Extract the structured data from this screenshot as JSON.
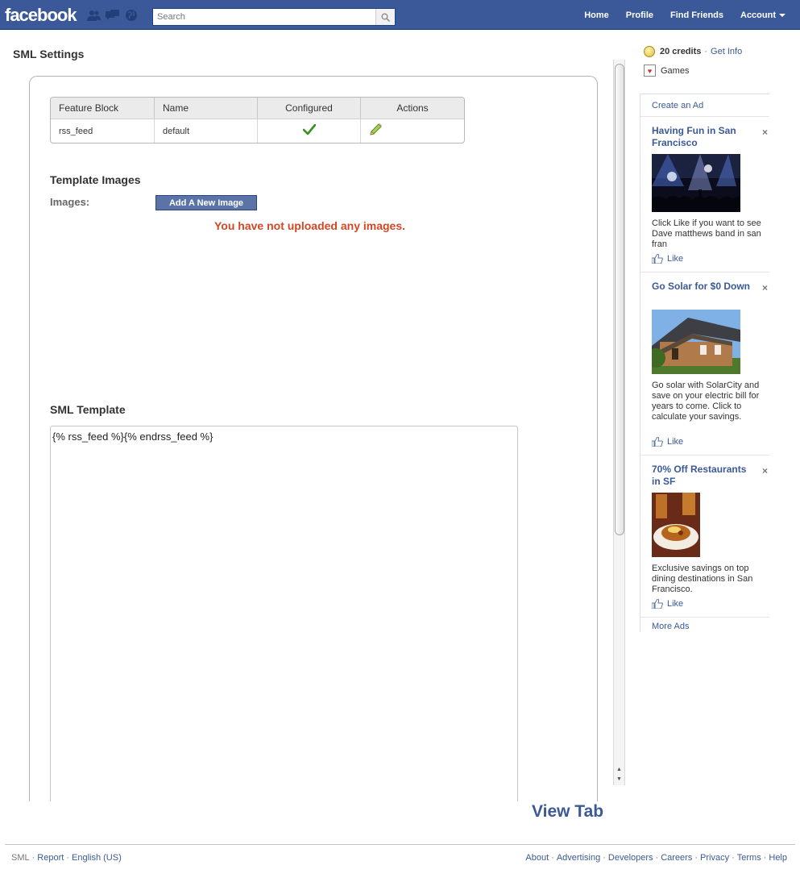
{
  "topbar": {
    "logo": "facebook",
    "search_placeholder": "Search",
    "nav": [
      "Home",
      "Profile",
      "Find Friends",
      "Account"
    ]
  },
  "main": {
    "page_title": "SML Settings",
    "table": {
      "headers": [
        "Feature Block",
        "Name",
        "Configured",
        "Actions"
      ],
      "rows": [
        {
          "feature_block": "rss_feed",
          "name": "default",
          "configured": "✔",
          "actions_icon": "pencil-icon"
        }
      ]
    },
    "template_images_title": "Template Images",
    "images_label": "Images:",
    "add_image_button": "Add A New Image",
    "no_images_message": "You have not uploaded any images.",
    "sml_template_title": "SML Template",
    "sml_template_value": "{% rss_feed %}{% endrss_feed %}",
    "view_tab": "View Tab"
  },
  "sidebar": {
    "credits_amount": "20 credits",
    "credits_link": "Get Info",
    "games_label": "Games",
    "create_ad": "Create an Ad",
    "ads": [
      {
        "title": "Having Fun in San Francisco",
        "body": "Click Like if you want to see Dave matthews band in san fran",
        "like": "Like",
        "image": "concert-photo"
      },
      {
        "title": "Go Solar for $0 Down",
        "body": "Go solar with SolarCity and save on your electric bill for years to come. Click to calculate your savings.",
        "like": "Like",
        "image": "house-solar-photo"
      },
      {
        "title": "70% Off Restaurants in SF",
        "body": "Exclusive savings on top dining destinations in San Francisco.",
        "like": "Like",
        "image": "food-photo"
      }
    ],
    "more_ads": "More Ads",
    "close_glyph": "×"
  },
  "footer": {
    "left": [
      "SML",
      "Report",
      "English (US)"
    ],
    "right": [
      "About",
      "Advertising",
      "Developers",
      "Careers",
      "Privacy",
      "Terms",
      "Help"
    ]
  },
  "colors": {
    "brand_blue": "#3b5998",
    "warning_red": "#d24726",
    "check_green": "#3a8f1e"
  }
}
